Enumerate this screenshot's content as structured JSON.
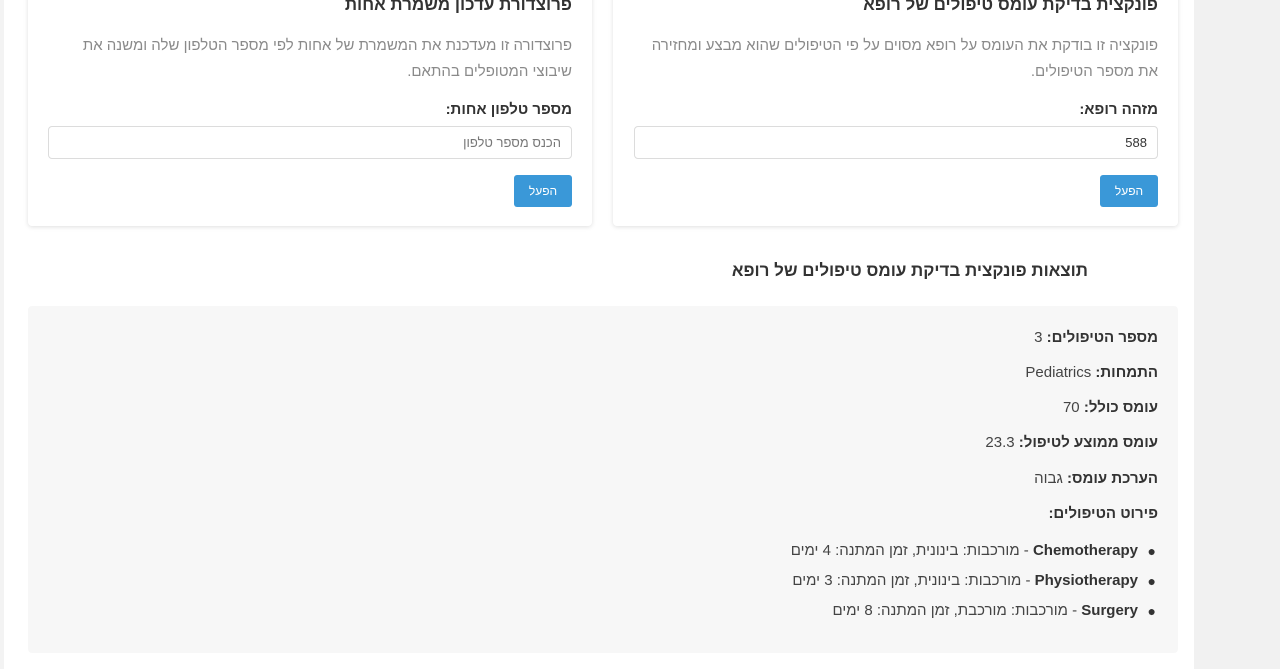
{
  "procedure_card": {
    "title": "פרוצדורת עדכון משמרת אחות",
    "description": "פרוצדורה זו מעדכנת את המשמרת של אחות לפי מספר הטלפון שלה ומשנה את שיבוצי המטופלים בהתאם.",
    "field_label": "מספר טלפון אחות:",
    "input_value": "",
    "input_placeholder": "הכנס מספר טלפון",
    "button_label": "הפעל"
  },
  "function_card": {
    "title": "פונקצית בדיקת עומס טיפולים של רופא",
    "description": "פונקציה זו בודקת את העומס על רופא מסוים על פי הטיפולים שהוא מבצע ומחזירה את מספר הטיפולים.",
    "field_label": "מזהה רופא:",
    "input_value": "588",
    "input_placeholder": "",
    "button_label": "הפעל"
  },
  "results": {
    "title": "תוצאות פונקצית בדיקת עומס טיפולים של רופא",
    "rows": [
      {
        "label": "מספר הטיפולים:",
        "value": "3"
      },
      {
        "label": "התמחות:",
        "value": "Pediatrics"
      },
      {
        "label": "עומס כולל:",
        "value": "70"
      },
      {
        "label": "עומס ממוצע לטיפול:",
        "value": "23.3"
      },
      {
        "label": "הערכת עומס:",
        "value": "גבוה"
      }
    ],
    "treatments_label": "פירוט הטיפולים:",
    "treatments": [
      {
        "name": "Chemotherapy",
        "details": " - מורכבות: בינונית, זמן המתנה: 4 ימים"
      },
      {
        "name": "Physiotherapy",
        "details": " - מורכבות: בינונית, זמן המתנה: 3 ימים"
      },
      {
        "name": "Surgery",
        "details": " - מורכבות: מורכבת, זמן המתנה: 8 ימים"
      }
    ]
  },
  "icons": {
    "bullet": "bullet-dot"
  }
}
